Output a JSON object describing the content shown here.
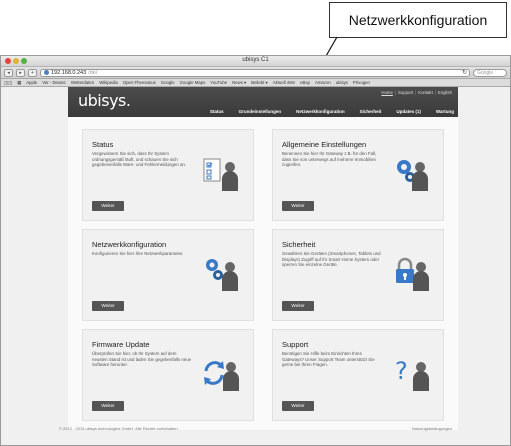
{
  "callout": {
    "label": "Netzwerkkonfiguration"
  },
  "browser": {
    "window_title": "ubisys C1",
    "url": "192.168.0.243",
    "url_suffix": "/de/",
    "search_placeholder": "Google",
    "bookmarks": [
      "Apple",
      "Ver - Deutsc",
      "Wetterdaten",
      "Wikipedia",
      "Open Fheesanus",
      "Google",
      "Google Maps",
      "YouTube",
      "News ▾",
      "Beliebt ▾",
      "Aktuell 49m",
      "eBay",
      "Amazon",
      "ubisys",
      "Privogen"
    ]
  },
  "site": {
    "logo": "ubisys.",
    "toplinks": [
      "Home",
      "Support",
      "Kontakt",
      "English"
    ],
    "nav": [
      "Status",
      "Grundeinstellungen",
      "Netzwerkkonfiguration",
      "Sicherheit",
      "Updates (1)",
      "Wartung"
    ]
  },
  "cards": [
    {
      "title": "Status",
      "text": "Vergewissern Sie sich, dass Ihr System ordnungsgemäß läuft, und schauen Sie sich gegebenenfalls Warn- und Fehlermeldungen an.",
      "button": "Weiter",
      "icon": "status-checklist-icon"
    },
    {
      "title": "Allgemeine Einstellungen",
      "text": "Benennen Sie hier Ihr Gateway z.B. für den Fall, dass Sie von unterwegs auf mehrere Immobilien zugreifen.",
      "button": "Weiter",
      "icon": "settings-gear-icon"
    },
    {
      "title": "Netzwerkkonfiguration",
      "text": "Konfigurieren Sie hier Ihre Netzwerkparameter.",
      "button": "Weiter",
      "icon": "network-icon"
    },
    {
      "title": "Sicherheit",
      "text": "Gewähren Sie Geräten (Smartphones, Tablets und Displays) Zugriff auf Ihr Smart Home System oder sperren Sie einzelne Geräte.",
      "button": "Weiter",
      "icon": "lock-icon"
    },
    {
      "title": "Firmware Update",
      "text": "Überprüfen Sie hier, ob Ihr System auf dem neusten Stand ist und laden Sie gegebenfalls neue Software herunter.",
      "button": "Weiter",
      "icon": "refresh-icon"
    },
    {
      "title": "Support",
      "text": "Benötigen Sie Hilfe beim Einrichten Ihres Gateways? Unser Support Team unterstützt Sie gerne bei Ihren Fragen.",
      "button": "Weiter",
      "icon": "question-icon"
    }
  ],
  "footer": {
    "copyright": "© 2012 - 2013 ubisys technologies GmbH. Alle Rechte vorbehalten.",
    "terms": "Nutzungsbedingungen"
  },
  "colors": {
    "header": "#3f3f3f",
    "button": "#555555",
    "icon_blue": "#3a78c8"
  }
}
